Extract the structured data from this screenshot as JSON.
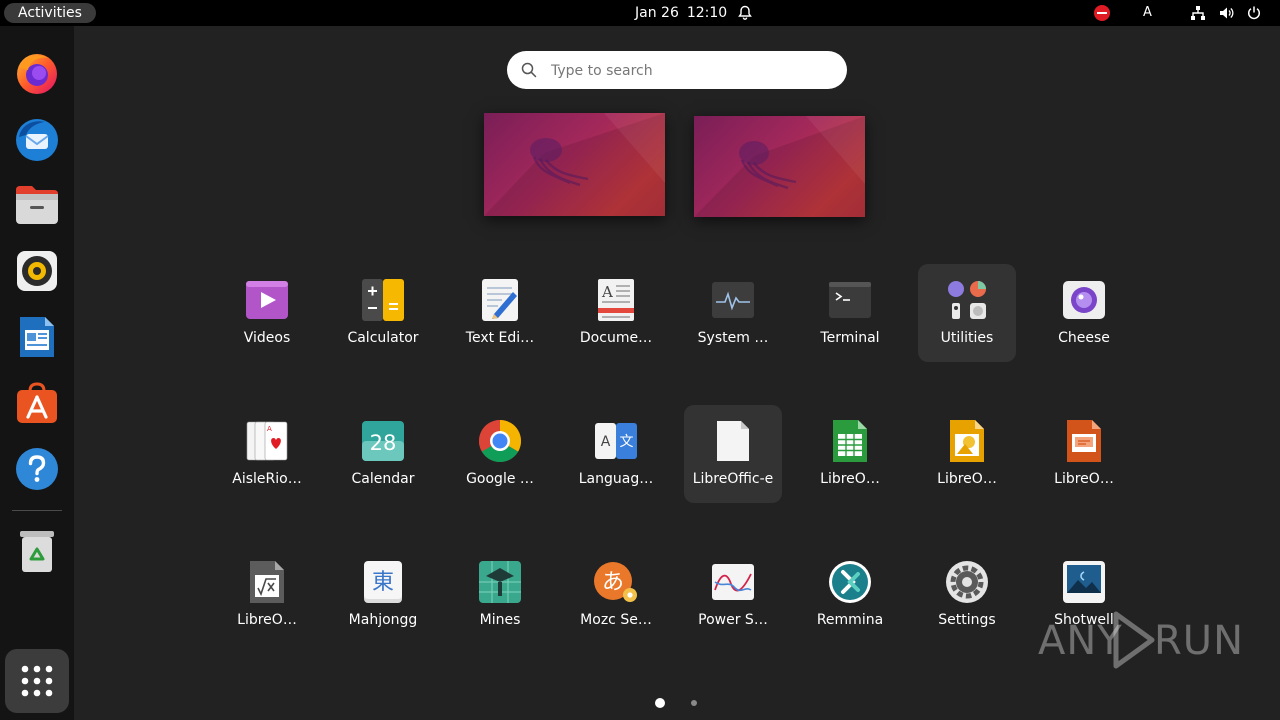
{
  "topbar": {
    "activities": "Activities",
    "date": "Jan 26",
    "time": "12:10",
    "keyboard_layout": "A",
    "icons": [
      "notification-bell-icon",
      "do-not-disturb-icon",
      "network-icon",
      "volume-icon",
      "power-icon"
    ]
  },
  "dock": {
    "items": [
      {
        "name": "firefox",
        "icon": "firefox-icon"
      },
      {
        "name": "thunderbird",
        "icon": "thunderbird-icon"
      },
      {
        "name": "files",
        "icon": "files-icon"
      },
      {
        "name": "rhythmbox",
        "icon": "rhythmbox-icon"
      },
      {
        "name": "libreoffice-writer",
        "icon": "writer-icon"
      },
      {
        "name": "app-center",
        "icon": "app-center-icon"
      },
      {
        "name": "help",
        "icon": "help-icon"
      },
      {
        "name": "trash",
        "icon": "trash-icon"
      }
    ],
    "show_apps_icon": "grid-icon"
  },
  "search": {
    "placeholder": "Type to search",
    "value": ""
  },
  "apps": [
    {
      "label": "Videos",
      "icon": "videos-icon"
    },
    {
      "label": "Calculator",
      "icon": "calculator-icon"
    },
    {
      "label": "Text Edi…",
      "icon": "text-editor-icon"
    },
    {
      "label": "Docume…",
      "icon": "document-viewer-icon"
    },
    {
      "label": "System …",
      "icon": "system-monitor-icon"
    },
    {
      "label": "Terminal",
      "icon": "terminal-icon"
    },
    {
      "label": "Utilities",
      "icon": "utilities-folder-icon"
    },
    {
      "label": "Cheese",
      "icon": "cheese-icon"
    },
    {
      "label": "AisleRio…",
      "icon": "aisleriot-icon"
    },
    {
      "label": "Calendar",
      "icon": "calendar-icon",
      "day": "28"
    },
    {
      "label": "Google …",
      "icon": "chrome-icon"
    },
    {
      "label": "Languag…",
      "icon": "language-support-icon"
    },
    {
      "label": "LibreOffic-e",
      "icon": "libreoffice-icon"
    },
    {
      "label": "LibreO…",
      "icon": "libreoffice-calc-icon"
    },
    {
      "label": "LibreO…",
      "icon": "libreoffice-draw-icon"
    },
    {
      "label": "LibreO…",
      "icon": "libreoffice-impress-icon"
    },
    {
      "label": "LibreO…",
      "icon": "libreoffice-math-icon"
    },
    {
      "label": "Mahjongg",
      "icon": "mahjongg-icon",
      "glyph": "東"
    },
    {
      "label": "Mines",
      "icon": "mines-icon"
    },
    {
      "label": "Mozc Se…",
      "icon": "mozc-icon",
      "glyph": "あ"
    },
    {
      "label": "Power S…",
      "icon": "power-statistics-icon"
    },
    {
      "label": "Remmina",
      "icon": "remmina-icon"
    },
    {
      "label": "Settings",
      "icon": "settings-icon"
    },
    {
      "label": "Shotwell",
      "icon": "shotwell-icon"
    }
  ],
  "pagination": {
    "current": 1,
    "total": 2
  },
  "watermark": {
    "left": "ANY",
    "right": "RUN"
  },
  "colors": {
    "accent": "#e95420",
    "background": "#222222",
    "topbar": "#000000"
  }
}
